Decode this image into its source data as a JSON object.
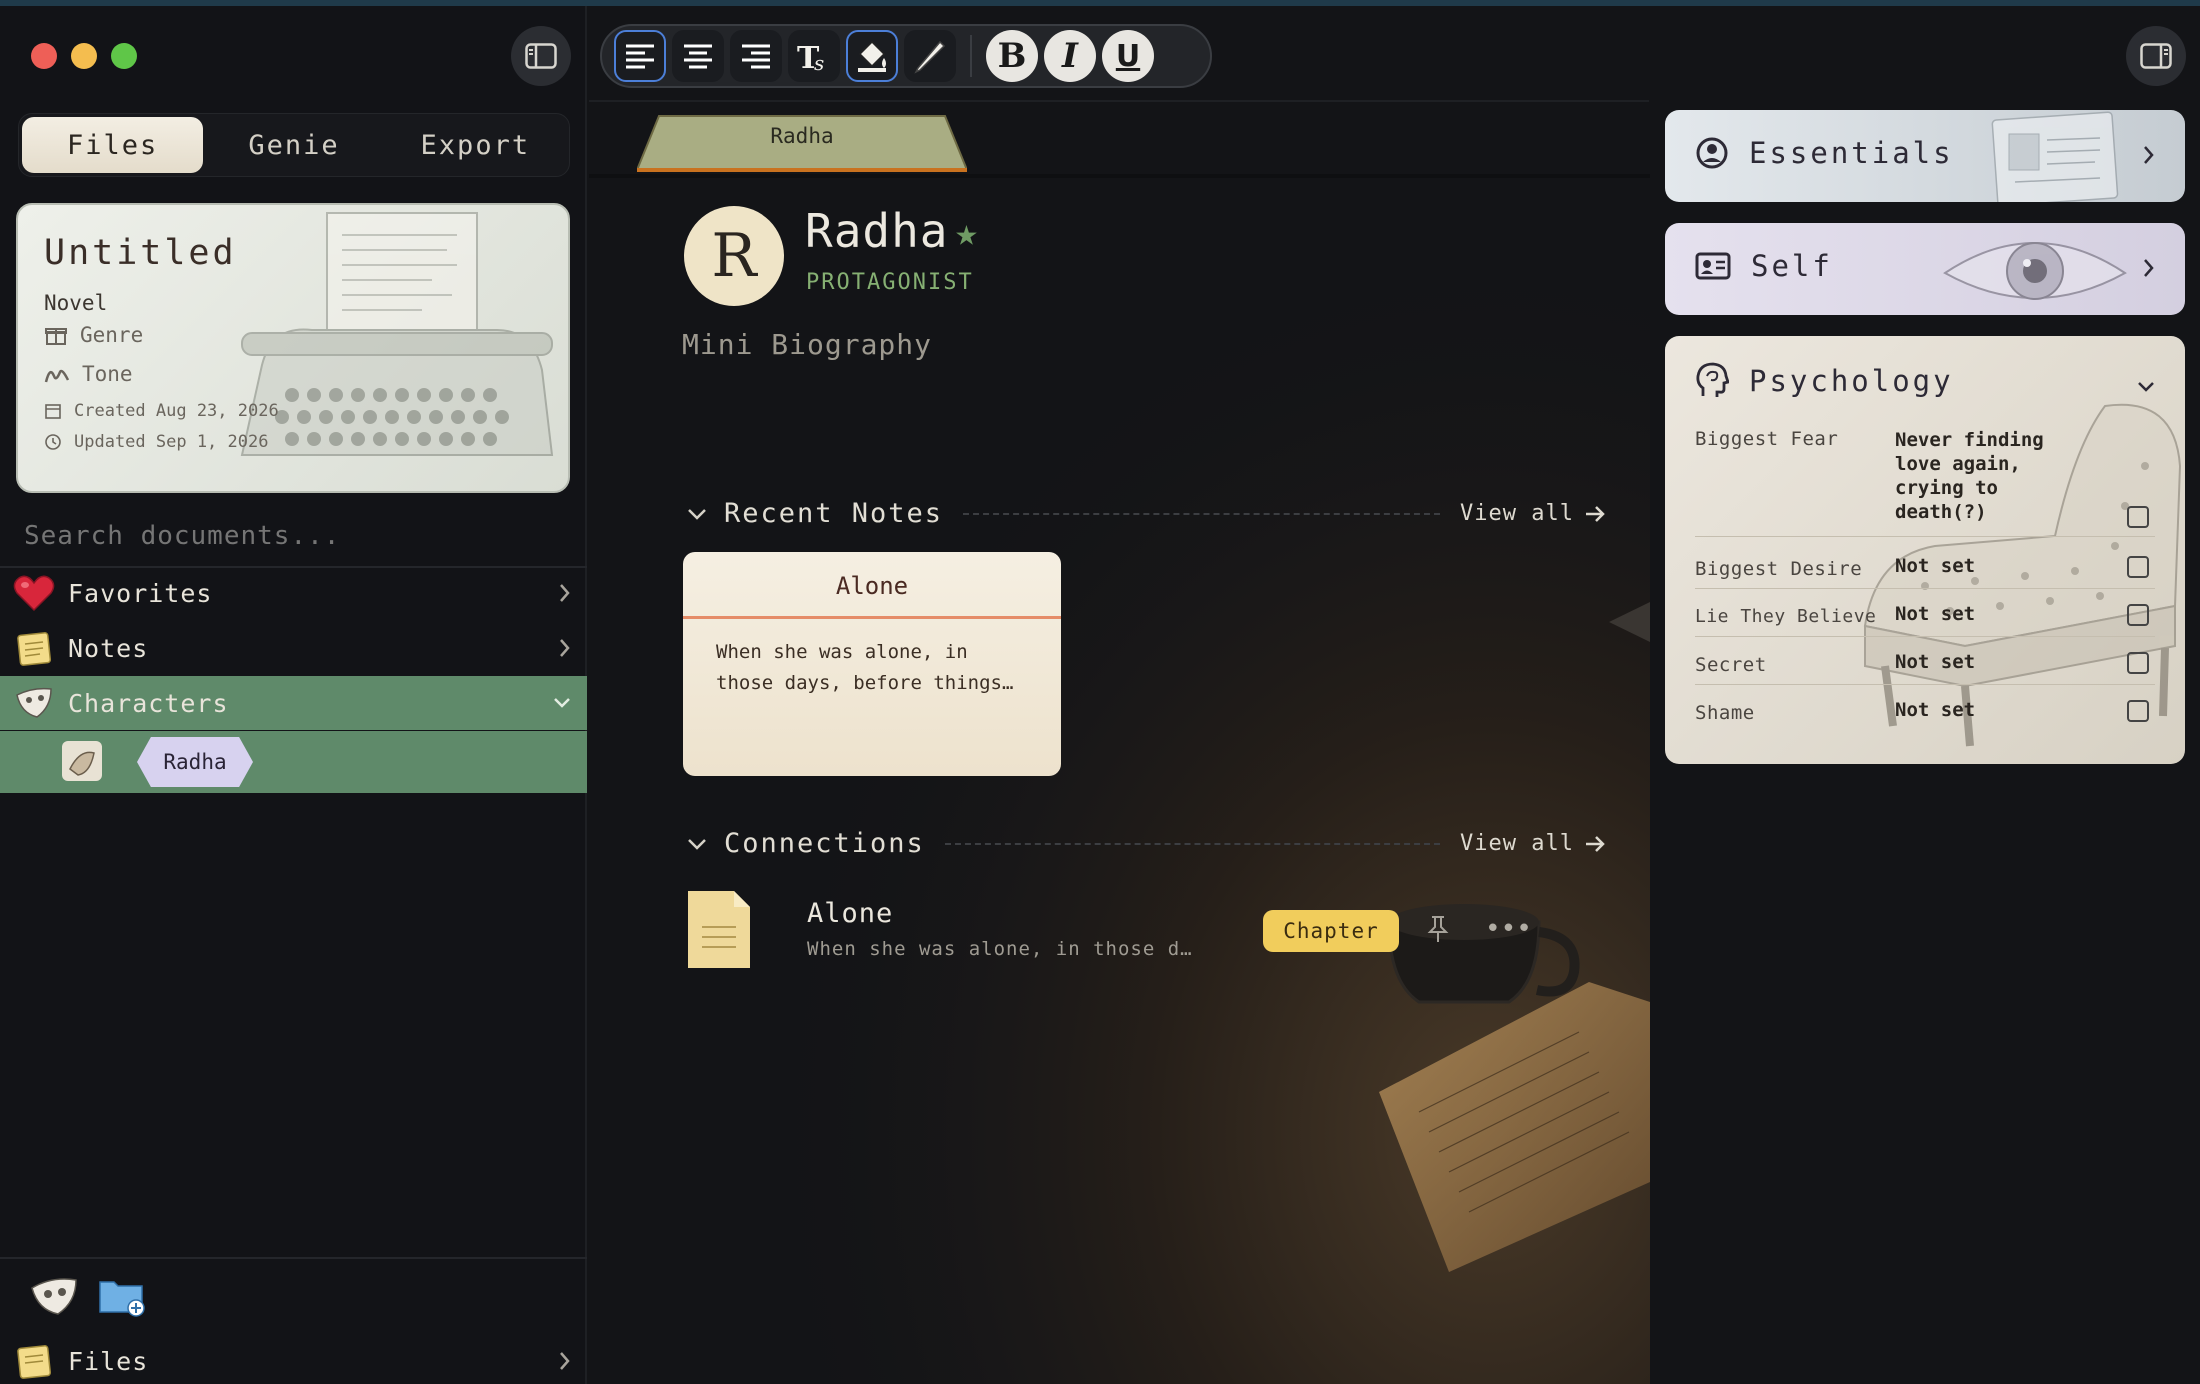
{
  "window": {
    "accent": "#5f8a6a"
  },
  "sidebar": {
    "tabs": [
      {
        "label": "Files",
        "active": true
      },
      {
        "label": "Genie",
        "active": false
      },
      {
        "label": "Export",
        "active": false
      }
    ],
    "project": {
      "title": "Untitled",
      "type": "Novel",
      "genre_label": "Genre",
      "tone_label": "Tone",
      "created": "Created Aug 23, 2026",
      "updated": "Updated Sep 1, 2026"
    },
    "search": {
      "placeholder": "Search documents..."
    },
    "nav": [
      {
        "label": "Favorites",
        "icon": "heart-icon"
      },
      {
        "label": "Notes",
        "icon": "notepad-icon"
      },
      {
        "label": "Characters",
        "icon": "mask-icon",
        "expanded": true
      }
    ],
    "characters": [
      {
        "label": "Radha"
      }
    ],
    "files_label": "Files"
  },
  "toolbar": {
    "bold": "B",
    "italic": "I",
    "underline": "U"
  },
  "document": {
    "tab_label": "Radha",
    "avatar_letter": "R",
    "name": "Radha",
    "role": "PROTAGONIST",
    "mini_bio_placeholder": "Mini Biography",
    "recent_notes": {
      "title": "Recent Notes",
      "view_all": "View all",
      "notes": [
        {
          "title": "Alone",
          "body": "When she was alone, in those days, before things…"
        }
      ]
    },
    "connections": {
      "title": "Connections",
      "view_all": "View all",
      "items": [
        {
          "title": "Alone",
          "subtitle": "When she was alone, in those d…",
          "badge": "Chapter"
        }
      ]
    }
  },
  "right_panel": {
    "essentials": {
      "title": "Essentials"
    },
    "self": {
      "title": "Self"
    },
    "psychology": {
      "title": "Psychology",
      "rows": [
        {
          "label": "Biggest Fear",
          "value": "Never finding love again, crying to death(?)"
        },
        {
          "label": "Biggest Desire",
          "value": "Not set"
        },
        {
          "label": "Lie They Believe",
          "value": "Not set"
        },
        {
          "label": "Secret",
          "value": "Not set"
        },
        {
          "label": "Shame",
          "value": "Not set"
        }
      ]
    }
  }
}
